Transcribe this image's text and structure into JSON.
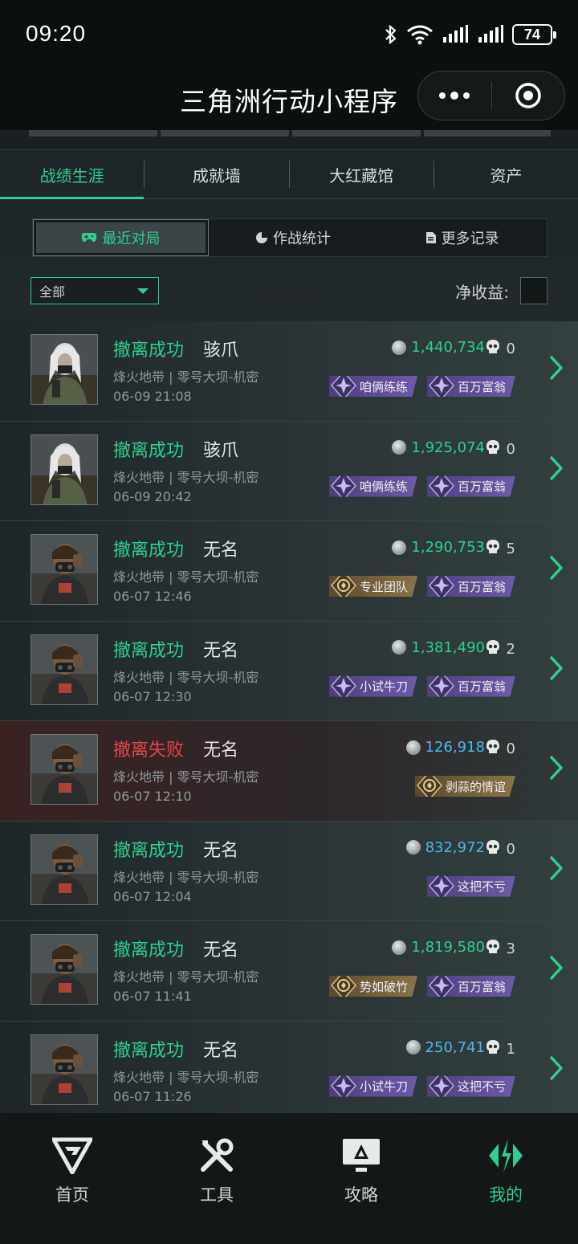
{
  "status_bar": {
    "time": "09:20",
    "battery": "74"
  },
  "title_bar": {
    "title": "三角洲行动小程序"
  },
  "tabs": [
    {
      "label": "战绩生涯",
      "active": true
    },
    {
      "label": "成就墙",
      "active": false
    },
    {
      "label": "大红藏馆",
      "active": false
    },
    {
      "label": "资产",
      "active": false
    }
  ],
  "subtabs": [
    {
      "label": "最近对局",
      "icon": "gamepad-icon",
      "active": true
    },
    {
      "label": "作战统计",
      "icon": "pie-chart-icon",
      "active": false
    },
    {
      "label": "更多记录",
      "icon": "document-icon",
      "active": false
    }
  ],
  "filter": {
    "selected": "全部"
  },
  "net_income_label": "净收益:",
  "colors": {
    "accent": "#2ecf8f",
    "fail": "#e0474b",
    "value_blue": "#4fb6e8"
  },
  "matches": [
    {
      "status": "撤离成功",
      "result": "success",
      "operator": "骇爪",
      "mode": "烽火地带 | 零号大坝-机密",
      "time": "06-09 21:08",
      "value": "1,440,734",
      "value_color": "green",
      "kills": "0",
      "badges": [
        {
          "label": "咱俩练练",
          "type": "purple"
        },
        {
          "label": "百万富翁",
          "type": "purple"
        }
      ]
    },
    {
      "status": "撤离成功",
      "result": "success",
      "operator": "骇爪",
      "mode": "烽火地带 | 零号大坝-机密",
      "time": "06-09 20:42",
      "value": "1,925,074",
      "value_color": "green",
      "kills": "0",
      "badges": [
        {
          "label": "咱俩练练",
          "type": "purple"
        },
        {
          "label": "百万富翁",
          "type": "purple"
        }
      ]
    },
    {
      "status": "撤离成功",
      "result": "success",
      "operator": "无名",
      "mode": "烽火地带 | 零号大坝-机密",
      "time": "06-07 12:46",
      "value": "1,290,753",
      "value_color": "green",
      "kills": "5",
      "badges": [
        {
          "label": "专业团队",
          "type": "gold"
        },
        {
          "label": "百万富翁",
          "type": "purple"
        }
      ]
    },
    {
      "status": "撤离成功",
      "result": "success",
      "operator": "无名",
      "mode": "烽火地带 | 零号大坝-机密",
      "time": "06-07 12:30",
      "value": "1,381,490",
      "value_color": "green",
      "kills": "2",
      "badges": [
        {
          "label": "小试牛刀",
          "type": "purple"
        },
        {
          "label": "百万富翁",
          "type": "purple"
        }
      ]
    },
    {
      "status": "撤离失败",
      "result": "fail",
      "operator": "无名",
      "mode": "烽火地带 | 零号大坝-机密",
      "time": "06-07 12:10",
      "value": "126,918",
      "value_color": "blue",
      "kills": "0",
      "badges": [
        {
          "label": "剥蒜的情谊",
          "type": "gold"
        }
      ]
    },
    {
      "status": "撤离成功",
      "result": "success",
      "operator": "无名",
      "mode": "烽火地带 | 零号大坝-机密",
      "time": "06-07 12:04",
      "value": "832,972",
      "value_color": "blue",
      "kills": "0",
      "badges": [
        {
          "label": "这把不亏",
          "type": "purple"
        }
      ]
    },
    {
      "status": "撤离成功",
      "result": "success",
      "operator": "无名",
      "mode": "烽火地带 | 零号大坝-机密",
      "time": "06-07 11:41",
      "value": "1,819,580",
      "value_color": "green",
      "kills": "3",
      "badges": [
        {
          "label": "势如破竹",
          "type": "gold"
        },
        {
          "label": "百万富翁",
          "type": "purple"
        }
      ]
    },
    {
      "status": "撤离成功",
      "result": "success",
      "operator": "无名",
      "mode": "烽火地带 | 零号大坝-机密",
      "time": "06-07 11:26",
      "value": "250,741",
      "value_color": "blue",
      "kills": "1",
      "badges": [
        {
          "label": "小试牛刀",
          "type": "purple"
        },
        {
          "label": "这把不亏",
          "type": "purple"
        }
      ]
    }
  ],
  "bottom_nav": [
    {
      "label": "首页",
      "icon": "home-logo-icon",
      "active": false
    },
    {
      "label": "工具",
      "icon": "tools-icon",
      "active": false
    },
    {
      "label": "攻略",
      "icon": "guide-monitor-icon",
      "active": false
    },
    {
      "label": "我的",
      "icon": "profile-logo-icon",
      "active": true
    }
  ]
}
